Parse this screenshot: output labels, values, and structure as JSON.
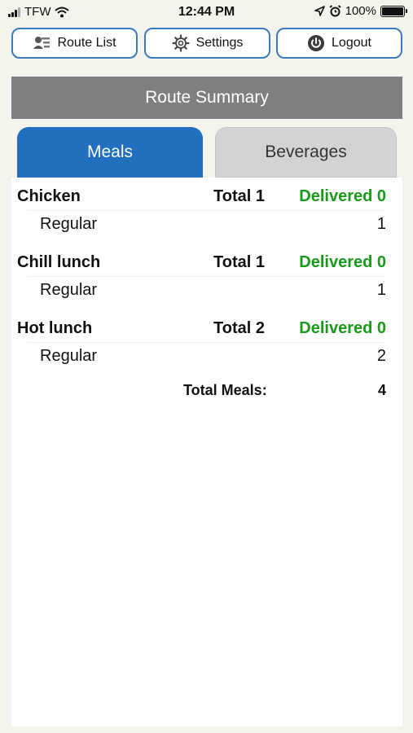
{
  "status_bar": {
    "carrier": "TFW",
    "time": "12:44 PM",
    "battery": "100%"
  },
  "toolbar": {
    "route_list_label": "Route List",
    "settings_label": "Settings",
    "logout_label": "Logout"
  },
  "header": {
    "title": "Route Summary"
  },
  "tabs": {
    "meals": "Meals",
    "beverages": "Beverages"
  },
  "meals": [
    {
      "name": "Chicken",
      "total_label": "Total 1",
      "delivered_label": "Delivered 0",
      "variant": "Regular",
      "count": "1"
    },
    {
      "name": "Chill lunch",
      "total_label": "Total 1",
      "delivered_label": "Delivered 0",
      "variant": "Regular",
      "count": "1"
    },
    {
      "name": "Hot lunch",
      "total_label": "Total 2",
      "delivered_label": "Delivered 0",
      "variant": "Regular",
      "count": "2"
    }
  ],
  "summary": {
    "label": "Total Meals:",
    "value": "4"
  },
  "colors": {
    "accent": "#2270bd",
    "delivered": "#1a9a1a",
    "header_bg": "#7f7f7f"
  }
}
